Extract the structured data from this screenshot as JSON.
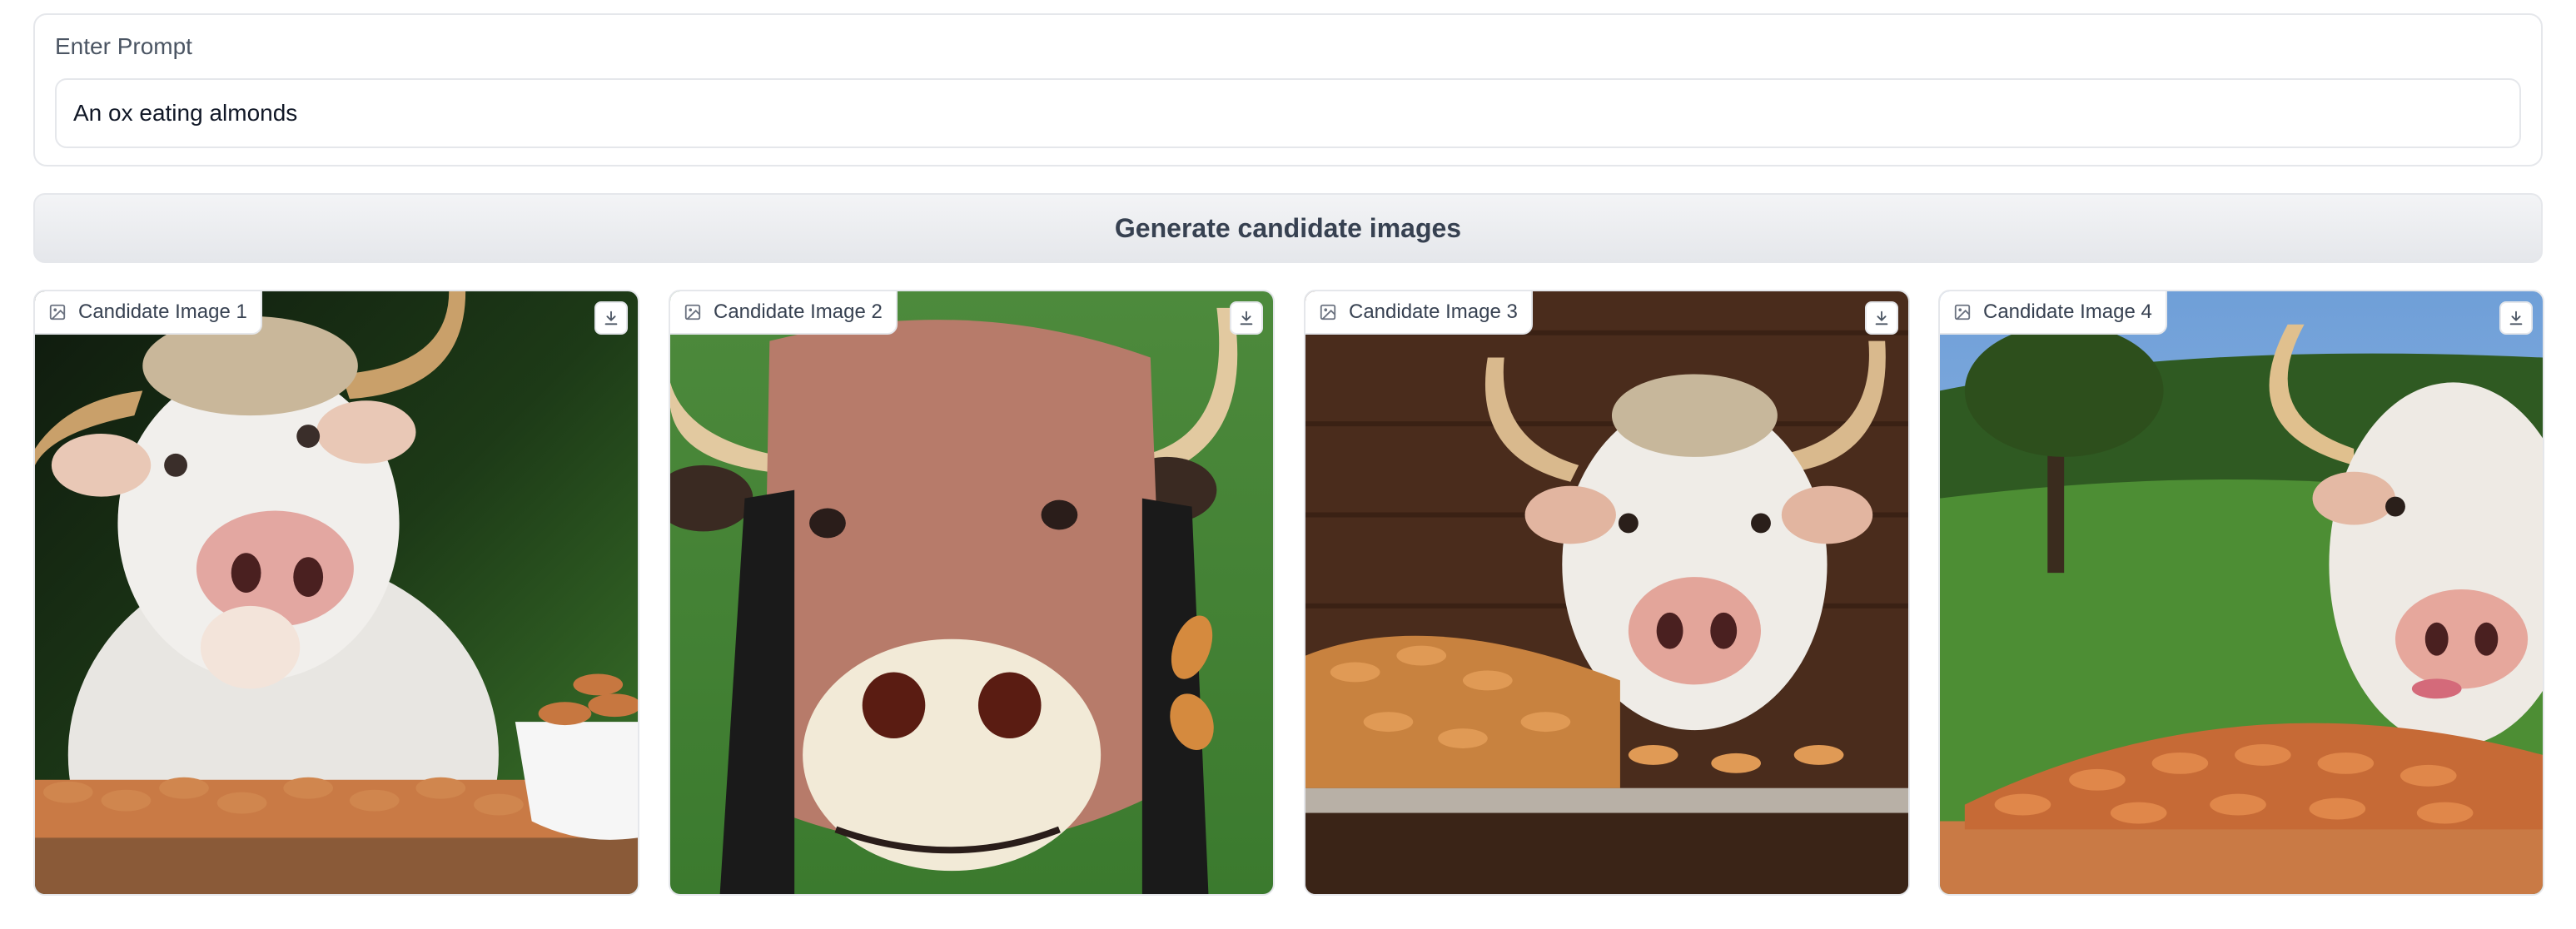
{
  "prompt": {
    "label": "Enter Prompt",
    "value": "An ox eating almonds"
  },
  "generate_button": {
    "label": "Generate candidate images"
  },
  "candidates": [
    {
      "label": "Candidate Image 1",
      "download_icon": "download-icon",
      "image_icon": "image-icon"
    },
    {
      "label": "Candidate Image 2",
      "download_icon": "download-icon",
      "image_icon": "image-icon"
    },
    {
      "label": "Candidate Image 3",
      "download_icon": "download-icon",
      "image_icon": "image-icon"
    },
    {
      "label": "Candidate Image 4",
      "download_icon": "download-icon",
      "image_icon": "image-icon"
    }
  ],
  "colors": {
    "border": "#e5e7eb",
    "button_bg": "#f3f4f6",
    "label_text": "#374151"
  }
}
